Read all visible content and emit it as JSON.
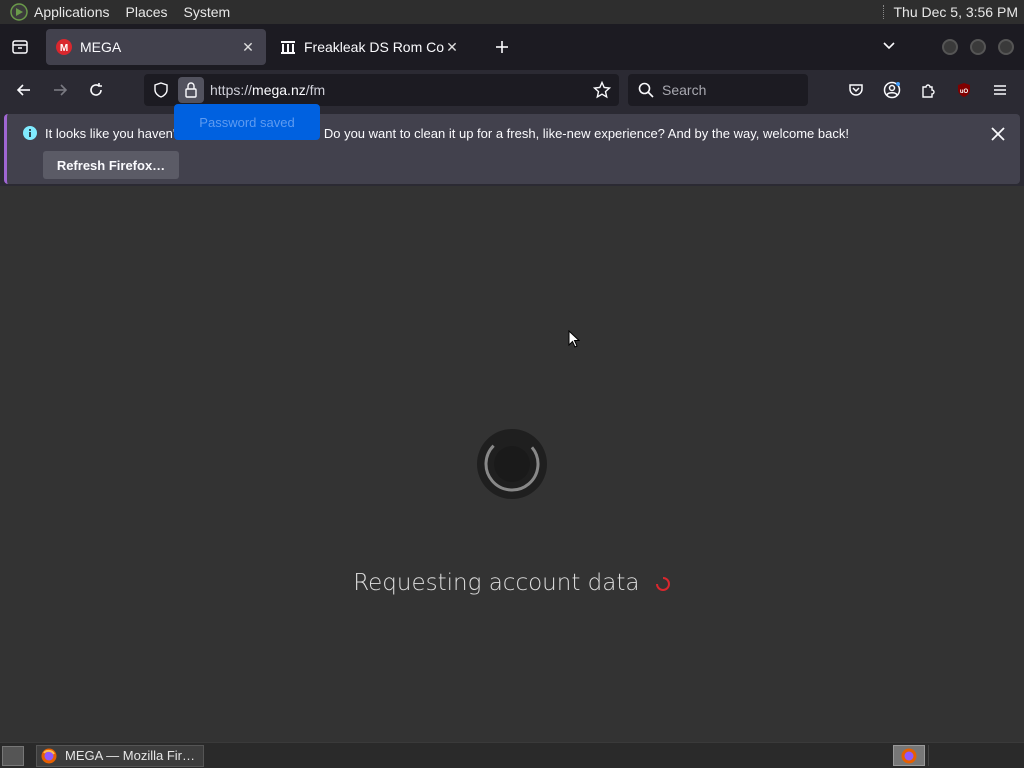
{
  "top_panel": {
    "menus": [
      "Applications",
      "Places",
      "System"
    ],
    "clock": "Thu Dec  5,  3:56 PM"
  },
  "tabs": [
    {
      "title": "MEGA",
      "active": true,
      "favicon": "mega-icon"
    },
    {
      "title": "Freakleak DS Rom Collectio",
      "active": false,
      "favicon": "archive-icon"
    }
  ],
  "urlbar": {
    "scheme": "https://",
    "host": "mega.nz",
    "path": "/fm"
  },
  "search": {
    "placeholder": "Search"
  },
  "password_popup": {
    "label": "Password saved"
  },
  "notification": {
    "message_left": "It looks like you haven'",
    "message_right": "e. Do you want to clean it up for a fresh, like-new experience? And by the way, welcome back!",
    "button": "Refresh Firefox…"
  },
  "content": {
    "status_text": "Requesting account data"
  },
  "taskbar": {
    "task_label": "MEGA — Mozilla Fir…"
  },
  "colors": {
    "accent_blue": "#0061e0",
    "mega_red": "#d9272e",
    "notification_stripe": "#a066d3"
  }
}
